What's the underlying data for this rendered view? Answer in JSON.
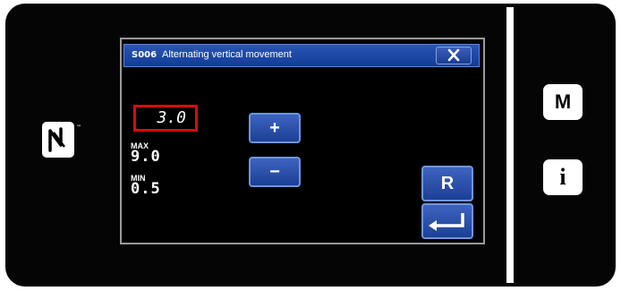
{
  "dialog": {
    "code": "S006",
    "title": "Alternating vertical movement"
  },
  "value": {
    "current": "3.0",
    "max_label": "MAX",
    "max_value": "9.0",
    "min_label": "MIN",
    "min_value": "0.5"
  },
  "buttons": {
    "plus": "+",
    "minus": "−",
    "reset": "R",
    "menu": "M",
    "info": "i"
  },
  "colors": {
    "accent": "#1c3f95",
    "highlight": "#d20e0e"
  },
  "icons": {
    "close": "close-icon",
    "enter": "enter-icon",
    "nfc": "nfc-icon"
  }
}
